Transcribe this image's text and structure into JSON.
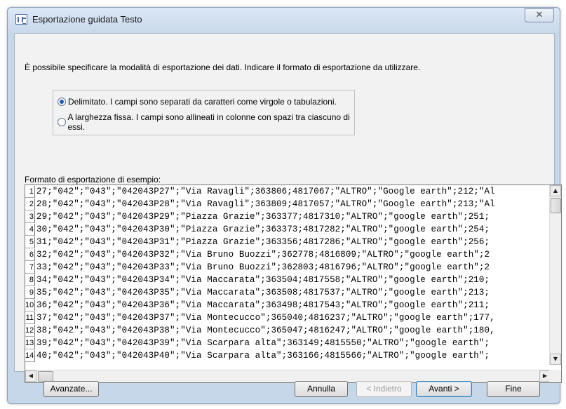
{
  "window": {
    "title": "Esportazione guidata Testo",
    "close_label": "✕"
  },
  "instruction": "È possibile specificare la modalità di esportazione dei dati. Indicare il formato di esportazione da utilizzare.",
  "format_options": [
    {
      "label": "Delimitato. I campi sono separati da caratteri come virgole o tabulazioni.",
      "selected": true
    },
    {
      "label": "A larghezza fissa. I campi sono allineati in colonne con spazi tra ciascuno di essi.",
      "selected": false
    }
  ],
  "preview": {
    "label": "Formato di esportazione di esempio:",
    "rows": [
      {
        "num": "1",
        "text": "27;\"042\";\"043\";\"042043P27\";\"Via Ravagli\";363806;4817067;\"ALTRO\";\"Google earth\";212;\"Al"
      },
      {
        "num": "2",
        "text": "28;\"042\";\"043\";\"042043P28\";\"Via Ravagli\";363809;4817057;\"ALTRO\";\"Google earth\";213;\"Al"
      },
      {
        "num": "3",
        "text": "29;\"042\";\"043\";\"042043P29\";\"Piazza Grazie\";363377;4817310;\"ALTRO\";\"google earth\";251;"
      },
      {
        "num": "4",
        "text": "30;\"042\";\"043\";\"042043P30\";\"Piazza Grazie\";363373;4817282;\"ALTRO\";\"google earth\";254;"
      },
      {
        "num": "5",
        "text": "31;\"042\";\"043\";\"042043P31\";\"Piazza Grazie\";363356;4817286;\"ALTRO\";\"google earth\";256;"
      },
      {
        "num": "6",
        "text": "32;\"042\";\"043\";\"042043P32\";\"Via Bruno Buozzi\";362778;4816809;\"ALTRO\";\"google earth\";2"
      },
      {
        "num": "7",
        "text": "33;\"042\";\"043\";\"042043P33\";\"Via Bruno Buozzi\";362803;4816796;\"ALTRO\";\"google earth\";2"
      },
      {
        "num": "8",
        "text": "34;\"042\";\"043\";\"042043P34\";\"Via Maccarata\";363504;4817558;\"ALTRO\";\"google earth\";210;"
      },
      {
        "num": "9",
        "text": "35;\"042\";\"043\";\"042043P35\";\"Via Maccarata\";363508;4817537;\"ALTRO\";\"google earth\";213;"
      },
      {
        "num": "10",
        "text": "36;\"042\";\"043\";\"042043P36\";\"Via Maccarata\";363498;4817543;\"ALTRO\";\"google earth\";211;"
      },
      {
        "num": "11",
        "text": "37;\"042\";\"043\";\"042043P37\";\"Via Montecucco\";365040;4816237;\"ALTRO\";\"google earth\";177,"
      },
      {
        "num": "12",
        "text": "38;\"042\";\"043\";\"042043P38\";\"Via Montecucco\";365047;4816247;\"ALTRO\";\"google earth\";180,"
      },
      {
        "num": "13",
        "text": "39;\"042\";\"043\";\"042043P39\";\"Via Scarpara alta\";363149;4815550;\"ALTRO\";\"google earth\";"
      },
      {
        "num": "14",
        "text": "40;\"042\";\"043\";\"042043P40\";\"Via Scarpara alta\";363166;4815566;\"ALTRO\";\"google earth\";"
      }
    ]
  },
  "buttons": {
    "advanced": "Avanzate...",
    "cancel": "Annulla",
    "back": "< Indietro",
    "next": "Avanti >",
    "finish": "Fine"
  },
  "scroll_icons": {
    "up": "▲",
    "down": "▼",
    "left": "◀",
    "right": "▶"
  }
}
